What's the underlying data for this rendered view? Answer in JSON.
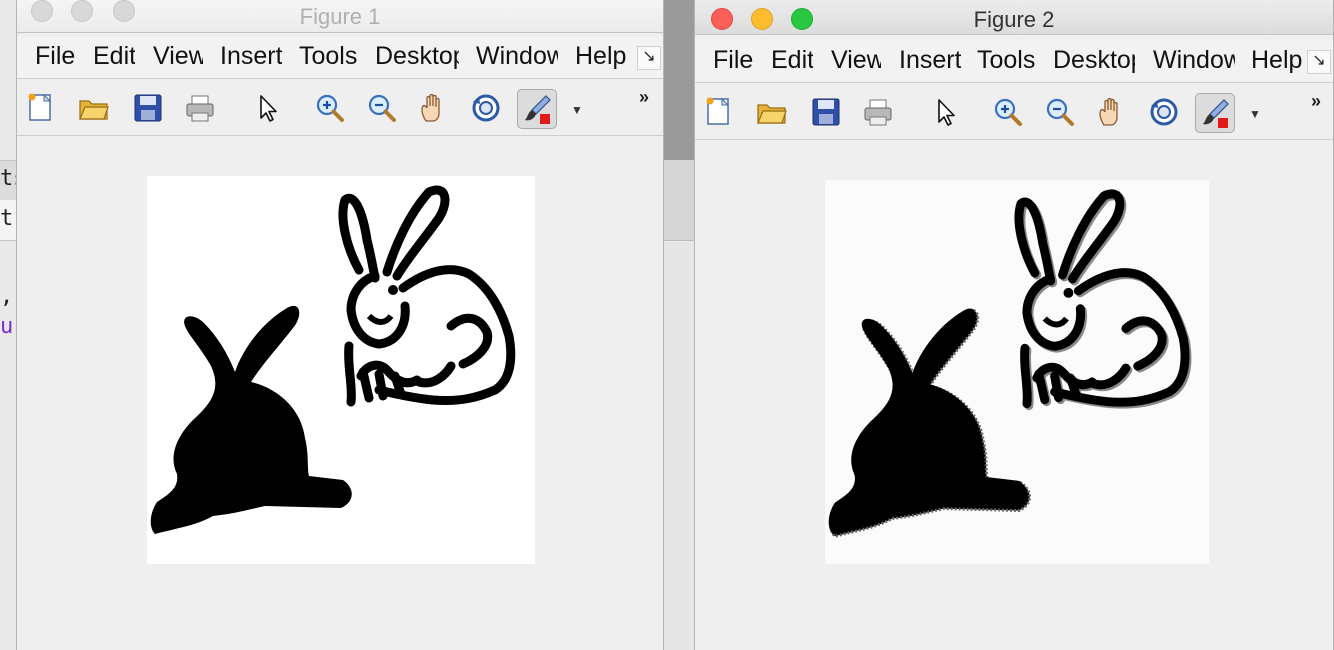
{
  "background_editor": {
    "fragments": [
      "ts",
      "t.",
      ",",
      "u"
    ],
    "purple": "#7a2bd1"
  },
  "figure1": {
    "title": "Figure 1",
    "state": "inactive",
    "menu": [
      "File",
      "Edit",
      "View",
      "Insert",
      "Tools",
      "Desktop",
      "Window",
      "Help"
    ],
    "toolbar": [
      "new-file-icon",
      "open-folder-icon",
      "save-icon",
      "print-icon",
      "select-arrow-icon",
      "zoom-in-icon",
      "zoom-out-icon",
      "pan-hand-icon",
      "rotate-3d-icon",
      "brush-icon"
    ],
    "overflow": "»",
    "image": "binary rabbits"
  },
  "figure2": {
    "title": "Figure 2",
    "state": "active",
    "menu": [
      "File",
      "Edit",
      "View",
      "Insert",
      "Tools",
      "Desktop",
      "Window",
      "Help"
    ],
    "toolbar": [
      "new-file-icon",
      "open-folder-icon",
      "save-icon",
      "print-icon",
      "select-arrow-icon",
      "zoom-in-icon",
      "zoom-out-icon",
      "pan-hand-icon",
      "rotate-3d-icon",
      "brush-icon"
    ],
    "overflow": "»",
    "image": "edge-filtered rabbits"
  },
  "colors": {
    "window_bg": "#efefef",
    "close": "#fc5f57",
    "minimize": "#fdbc2e",
    "zoom": "#28c840"
  }
}
